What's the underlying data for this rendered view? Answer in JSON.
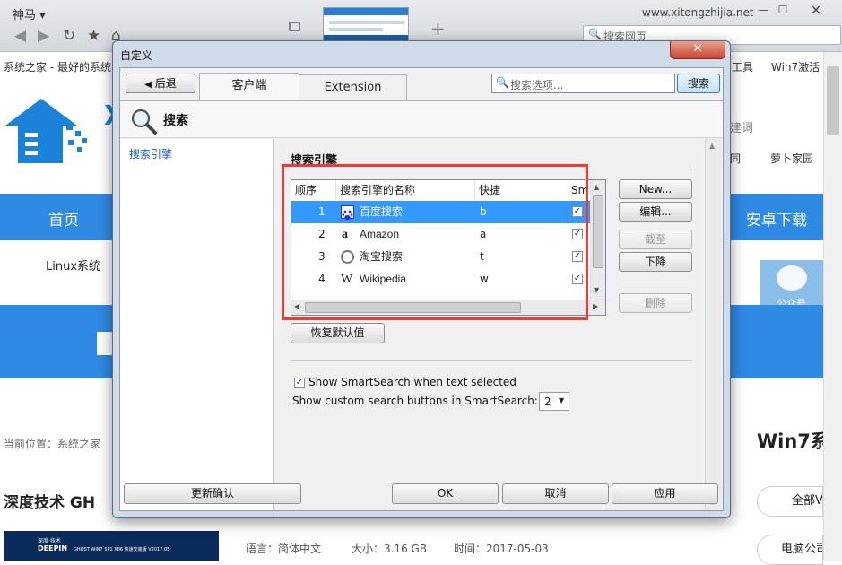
{
  "browser": {
    "app_name": "神马",
    "url": "www.xitongzhijia.net",
    "search_placeholder": "搜索网页",
    "nav_icons": [
      "back-arrow-icon",
      "forward-arrow-icon",
      "refresh-icon",
      "star-icon",
      "home-icon"
    ]
  },
  "page": {
    "tab_title": "系统之家 - 最好的系统",
    "toolbar_links": [
      "工具",
      "Win7激活"
    ],
    "nav": [
      "首页",
      "安卓下载"
    ],
    "sub_nav": [
      "Linux系统",
      "萝卜家园",
      "同"
    ],
    "search_hint": "建词",
    "side_widget": "公众号",
    "logo_text": "X",
    "breadcrumb": "当前位置：系统之家",
    "win7_heading": "Win7系",
    "article_title": "深度技术 GH",
    "all_button": "全部V",
    "pc_button": "电脑公司",
    "meta_language": "语言：简体中文",
    "meta_size": "大小：3.16 GB",
    "meta_time": "时间：2017-05-03",
    "thumb_brand": "深度·技术",
    "thumb_logo": "DEEPIN",
    "thumb_text": "GHOST WIN7 SP1 X86 快速安装版 V2017.05"
  },
  "dialog": {
    "title": "自定义",
    "close_label": "✕",
    "back_button": "后退",
    "tabs": [
      "客户端",
      "Extension"
    ],
    "search_placeholder": "搜索选项...",
    "search_button": "搜索",
    "header_title": "搜索",
    "left_item": "搜索引擎",
    "section_title": "搜索引擎",
    "columns": [
      "顺序",
      "搜索引擎的名称",
      "快捷",
      "Sm"
    ],
    "engines": [
      {
        "order": "1",
        "icon": "baidu-paw-icon",
        "name": "百度搜索",
        "shortcut": "b",
        "checked": true,
        "selected": true
      },
      {
        "order": "2",
        "icon": "amazon-icon",
        "name": "Amazon",
        "shortcut": "a",
        "checked": true,
        "selected": false
      },
      {
        "order": "3",
        "icon": "globe-icon",
        "name": "淘宝搜索",
        "shortcut": "t",
        "checked": true,
        "selected": false
      },
      {
        "order": "4",
        "icon": "wikipedia-icon",
        "name": "Wikipedia",
        "shortcut": "w",
        "checked": true,
        "selected": false
      }
    ],
    "buttons": {
      "new": "New...",
      "edit": "编辑...",
      "up": "截至",
      "down": "下降",
      "delete": "删除",
      "restore": "恢复默认值"
    },
    "smartsearch_label": "Show SmartSearch when text selected",
    "smartsearch_checked": true,
    "custom_buttons_label": "Show custom search buttons in SmartSearch:",
    "custom_buttons_value": "2",
    "footer": {
      "update": "更新确认",
      "ok": "OK",
      "cancel": "取消",
      "apply": "应用"
    },
    "highlight_color": "#ec3b3b",
    "selection_color": "#3399ff"
  }
}
